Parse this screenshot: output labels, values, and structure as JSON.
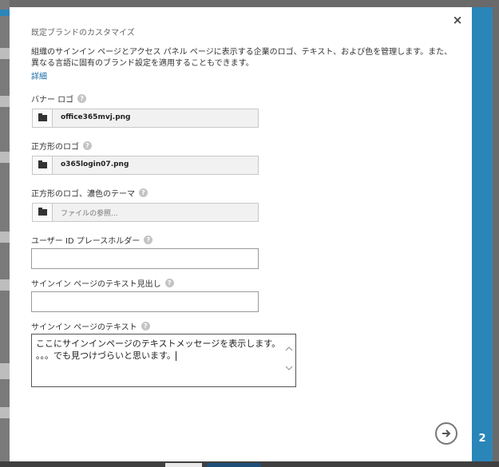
{
  "dialog": {
    "title": "既定ブランドのカスタマイズ",
    "close_label": "×",
    "description": "組織のサインイン ページとアクセス パネル ページに表示する企業のロゴ、テキスト、および色を管理します。また、異なる言語に固有のブランド設定を適用することもできます。",
    "more_link": "詳細",
    "step_number": "2",
    "help_glyph": "?"
  },
  "fields": {
    "banner_logo": {
      "label": "バナー ロゴ",
      "file": "office365mvj.png"
    },
    "square_logo": {
      "label": "正方形のロゴ",
      "file": "o365login07.png"
    },
    "square_logo_dark": {
      "label": "正方形のロゴ、濃色のテーマ",
      "placeholder": "ファイルの参照..."
    },
    "user_id_placeholder": {
      "label": "ユーザー ID プレースホルダー",
      "value": ""
    },
    "signin_heading": {
      "label": "サインイン ページのテキスト見出し",
      "value": ""
    },
    "signin_text": {
      "label": "サインイン ページのテキスト",
      "line1": "ここにサインインページのテキストメッセージを表示します。",
      "line2": "。。。でも見つけづらいと思います。"
    }
  },
  "icons": {
    "browse": "folder-icon",
    "help": "help-icon",
    "next": "arrow-right-icon",
    "close": "close-icon"
  },
  "colors": {
    "accent": "#2a86b8",
    "link": "#1a6aa8"
  }
}
